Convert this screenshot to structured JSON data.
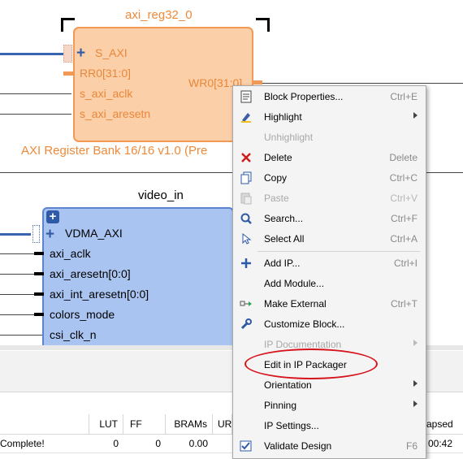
{
  "diagram": {
    "axi_reg": {
      "name": "axi_reg32_0",
      "ports_left": [
        "S_AXI",
        "RR0[31:0]",
        "s_axi_aclk",
        "s_axi_aresetn"
      ],
      "port_right": "WR0[31:0]",
      "subtitle": "AXI Register Bank 16/16 v1.0 (Pre"
    },
    "video_in": {
      "name": "video_in",
      "ports": [
        "VDMA_AXI",
        "axi_aclk",
        "axi_aresetn[0:0]",
        "axi_int_aresetn[0:0]",
        "colors_mode",
        "csi_clk_n"
      ]
    }
  },
  "results_table": {
    "headers": [
      "LUT",
      "FF",
      "BRAMs",
      "UR",
      "apsed"
    ],
    "row": {
      "status": "Complete!",
      "lut": "0",
      "ff": "0",
      "brams": "0.00",
      "elapsed": "00:42"
    }
  },
  "context_menu": {
    "items": [
      {
        "label": "Block Properties...",
        "shortcut": "Ctrl+E",
        "icon": "properties-icon",
        "disabled": false,
        "submenu": false
      },
      {
        "label": "Highlight",
        "shortcut": "",
        "icon": "highlight-icon",
        "disabled": false,
        "submenu": true
      },
      {
        "label": "Unhighlight",
        "shortcut": "",
        "icon": "",
        "disabled": true,
        "submenu": false
      },
      {
        "label": "Delete",
        "shortcut": "Delete",
        "icon": "delete-icon",
        "disabled": false,
        "submenu": false
      },
      {
        "label": "Copy",
        "shortcut": "Ctrl+C",
        "icon": "copy-icon",
        "disabled": false,
        "submenu": false
      },
      {
        "label": "Paste",
        "shortcut": "Ctrl+V",
        "icon": "paste-icon",
        "disabled": true,
        "submenu": false
      },
      {
        "label": "Search...",
        "shortcut": "Ctrl+F",
        "icon": "search-icon",
        "disabled": false,
        "submenu": false
      },
      {
        "label": "Select All",
        "shortcut": "Ctrl+A",
        "icon": "select-all-icon",
        "disabled": false,
        "submenu": false
      },
      {
        "label": "Add IP...",
        "shortcut": "Ctrl+I",
        "icon": "add-icon",
        "disabled": false,
        "submenu": false
      },
      {
        "label": "Add Module...",
        "shortcut": "",
        "icon": "",
        "disabled": false,
        "submenu": false
      },
      {
        "label": "Make External",
        "shortcut": "Ctrl+T",
        "icon": "make-external-icon",
        "disabled": false,
        "submenu": false
      },
      {
        "label": "Customize Block...",
        "shortcut": "",
        "icon": "wrench-icon",
        "disabled": false,
        "submenu": false
      },
      {
        "label": "IP Documentation",
        "shortcut": "",
        "icon": "",
        "disabled": true,
        "submenu": true
      },
      {
        "label": "Edit in IP Packager",
        "shortcut": "",
        "icon": "",
        "disabled": false,
        "submenu": false
      },
      {
        "label": "Orientation",
        "shortcut": "",
        "icon": "",
        "disabled": false,
        "submenu": true
      },
      {
        "label": "Pinning",
        "shortcut": "",
        "icon": "",
        "disabled": false,
        "submenu": true
      },
      {
        "label": "IP Settings...",
        "shortcut": "",
        "icon": "",
        "disabled": false,
        "submenu": false
      },
      {
        "label": "Validate Design",
        "shortcut": "F6",
        "icon": "validate-icon",
        "disabled": false,
        "submenu": false
      }
    ]
  },
  "colors": {
    "highlight_ellipse": "#d6141b",
    "axi_block_fill": "#fbcfa8",
    "video_block_fill": "#a9c4f1"
  }
}
